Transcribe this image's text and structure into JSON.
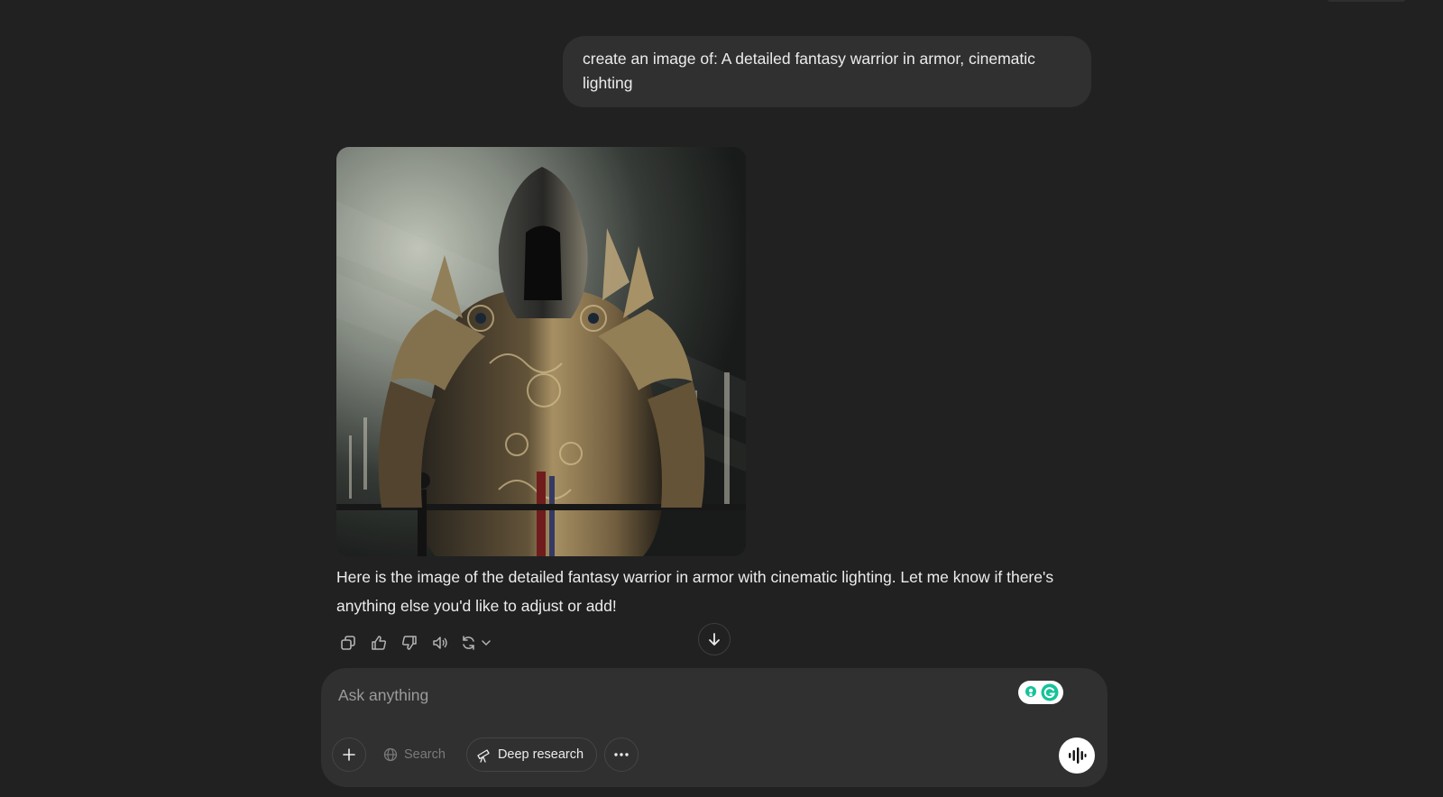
{
  "user_message": {
    "text": "create an image of: A detailed fantasy warrior in armor, cinematic lighting"
  },
  "assistant": {
    "image_alt": "detailed fantasy warrior in ornate armor with cinematic lighting",
    "text": "Here is the image of the detailed fantasy warrior in armor with cinematic lighting. Let me know if there's anything else you'd like to adjust or add!",
    "actions": [
      {
        "name": "copy-button",
        "icon": "copy-icon"
      },
      {
        "name": "thumbs-up-button",
        "icon": "thumbs-up-icon"
      },
      {
        "name": "thumbs-down-button",
        "icon": "thumbs-down-icon"
      },
      {
        "name": "read-aloud-button",
        "icon": "speaker-icon"
      },
      {
        "name": "regenerate-button",
        "icon": "refresh-icon"
      }
    ]
  },
  "composer": {
    "placeholder": "Ask anything",
    "tools": {
      "attach_icon": "plus-icon",
      "search_label": "Search",
      "deep_research_label": "Deep research",
      "more_icon": "ellipsis-icon"
    },
    "voice_icon": "voice-wave-icon"
  },
  "colors": {
    "background": "#212121",
    "surface": "#303030",
    "text": "#ececec",
    "muted": "#9b9b9b",
    "grammarly": "#15c39a"
  }
}
